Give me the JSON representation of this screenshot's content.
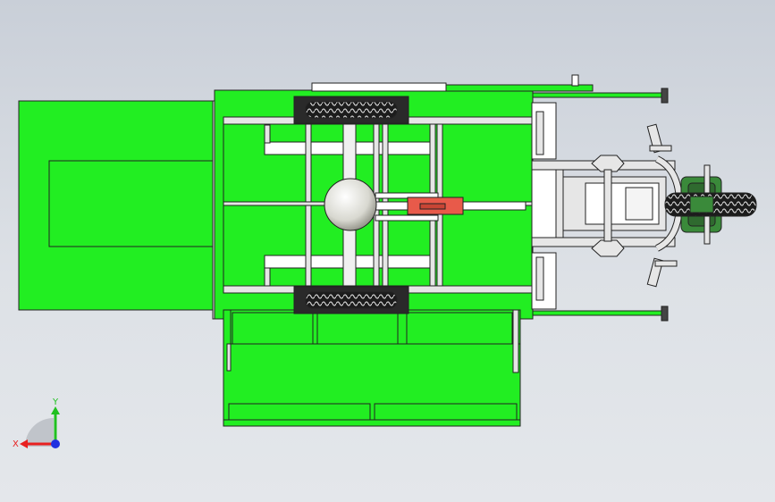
{
  "viewport": {
    "background_top": "#c9cfd8",
    "background_bottom": "#e4e7eb"
  },
  "model": {
    "body_color": "#22ee22",
    "frame_color": "#e6e6e6",
    "edge_color": "#222222",
    "tire_color": "#2a2a2a",
    "accent_red": "#e85a4a",
    "hub_color": "#f4f4f0"
  },
  "triad": {
    "x_label": "X",
    "y_label": "Y",
    "x_color": "#e82020",
    "y_color": "#20c020",
    "z_color": "#2030e0"
  }
}
